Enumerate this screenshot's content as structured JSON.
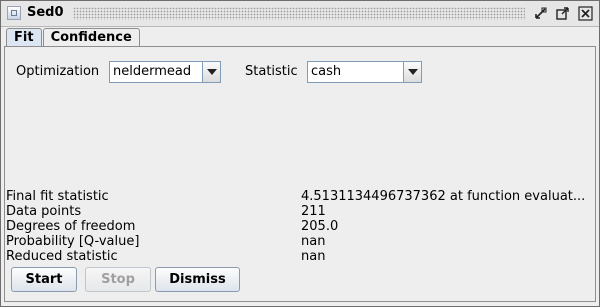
{
  "window": {
    "title": "Sed0",
    "controls": {
      "minimize_icon": "iconify-icon",
      "maximize_icon": "maximize-icon",
      "close_icon": "close-icon"
    }
  },
  "tabs": [
    {
      "label": "Fit",
      "active": true
    },
    {
      "label": "Confidence",
      "active": false
    }
  ],
  "fit": {
    "optimization": {
      "label": "Optimization",
      "value": "neldermead"
    },
    "statistic": {
      "label": "Statistic",
      "value": "cash"
    }
  },
  "results": [
    {
      "label": "Final fit statistic",
      "value": "4.5131134496737362  at function evaluat..."
    },
    {
      "label": "Data points",
      "value": "211"
    },
    {
      "label": "Degrees of freedom",
      "value": "205.0"
    },
    {
      "label": "Probability [Q-value]",
      "value": "nan"
    },
    {
      "label": "Reduced statistic",
      "value": "nan"
    }
  ],
  "buttons": {
    "start": "Start",
    "stop": "Stop",
    "dismiss": "Dismiss"
  }
}
